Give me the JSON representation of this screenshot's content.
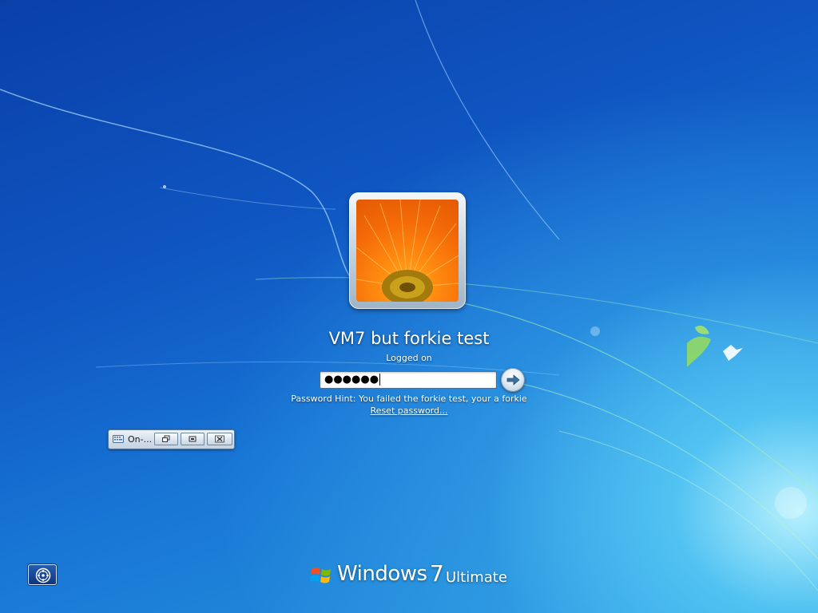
{
  "user": {
    "name": "VM7 but forkie test",
    "status": "Logged on"
  },
  "login": {
    "password_masked": "●●●●●●",
    "password_hint": "Password Hint: You failed the forkie test, your a forkie",
    "reset_link": "Reset password..."
  },
  "osk": {
    "title": "On-..."
  },
  "branding": {
    "product": "Windows",
    "version": "7",
    "edition": "Ultimate"
  },
  "icons": {
    "submit": "arrow-right-icon",
    "osk": "keyboard-icon",
    "restore": "restore-icon",
    "minimize": "minimize-icon",
    "close": "close-icon",
    "ease_of_access": "ease-of-access-icon",
    "logo": "windows-flag-icon"
  },
  "colors": {
    "background_dark": "#0a3fa8",
    "background_light": "#2a9ae0",
    "text": "#ffffff"
  }
}
